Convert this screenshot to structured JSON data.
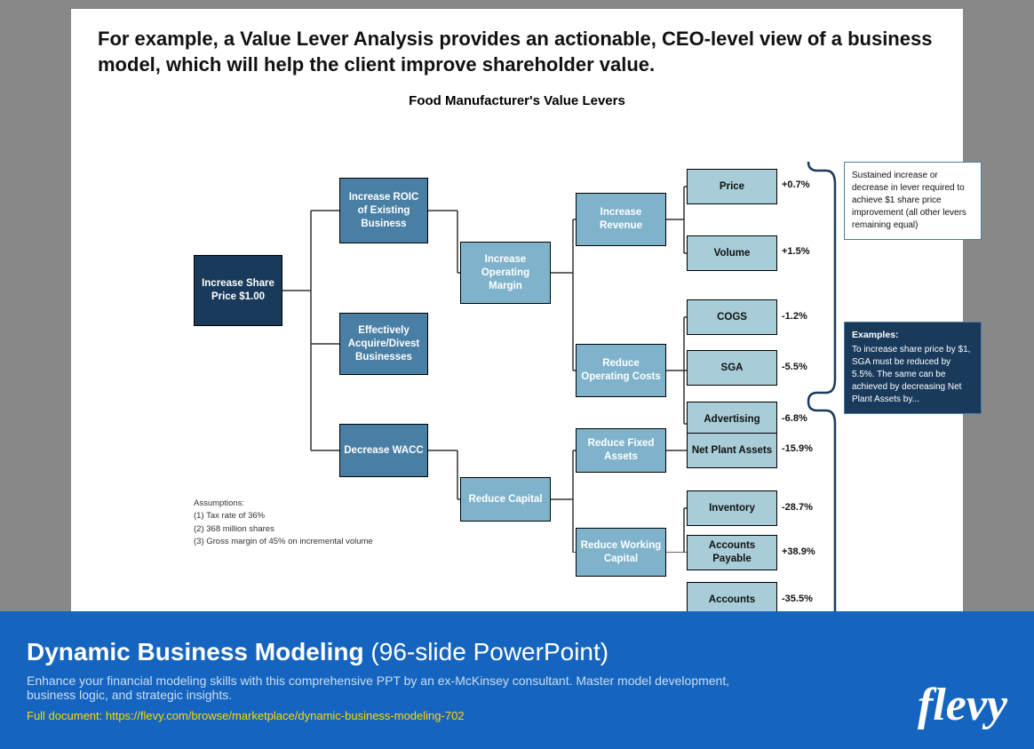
{
  "headline": "For example, a Value Lever Analysis provides an actionable, CEO-level view of a business model, which will help the client improve shareholder value.",
  "chart_title": "Food Manufacturer's Value Levers",
  "boxes": {
    "increase_share_price": "Increase Share Price $1.00",
    "increase_roic": "Increase ROIC of Existing Business",
    "effectively_acquire": "Effectively Acquire/Divest Businesses",
    "decrease_wacc": "Decrease WACC",
    "increase_operating_margin": "Increase Operating Margin",
    "reduce_capital": "Reduce Capital",
    "increase_revenue": "Increase Revenue",
    "reduce_operating_costs": "Reduce Operating Costs",
    "reduce_fixed_assets": "Reduce Fixed Assets",
    "reduce_working_capital": "Reduce Working Capital",
    "price": "Price",
    "volume": "Volume",
    "cogs": "COGS",
    "sga": "SGA",
    "advertising": "Advertising",
    "net_plant_assets": "Net Plant Assets",
    "inventory": "Inventory",
    "accounts_payable": "Accounts Payable",
    "accounts": "Accounts"
  },
  "percentages": {
    "price": "+0.7%",
    "volume": "+1.5%",
    "cogs": "-1.2%",
    "sga": "-5.5%",
    "advertising": "-6.8%",
    "net_plant_assets": "-15.9%",
    "inventory": "-28.7%",
    "accounts_payable": "+38.9%",
    "accounts": "-35.5%"
  },
  "panel_sustained": "Sustained increase or decrease in lever required to achieve $1 share price improvement (all other levers remaining equal)",
  "panel_examples_title": "Examples:",
  "panel_examples_text": "To increase share price by $1, SGA must be reduced by 5.5%. The same can be achieved by decreasing Net Plant Assets by...",
  "assumptions": {
    "title": "Assumptions:",
    "items": [
      "(1)  Tax rate of 36%",
      "(2)  368 million shares",
      "(3)  Gross margin of 45% on incremental volume"
    ]
  },
  "footer": {
    "title_bold": "Dynamic Business Modeling",
    "title_normal": " (96-slide PowerPoint)",
    "subtitle": "Enhance your financial modeling skills with this comprehensive PPT by an ex-McKinsey consultant. Master model development, business logic, and strategic insights.",
    "link_label": "Full document: https://flevy.com/browse/marketplace/dynamic-business-modeling-702",
    "logo": "flevy"
  }
}
